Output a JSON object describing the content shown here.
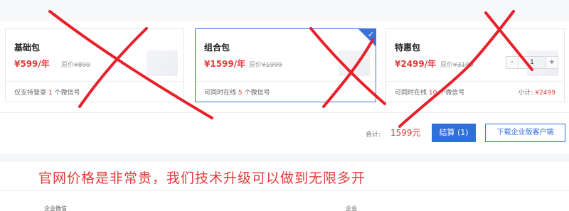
{
  "packages": [
    {
      "name": "基础包",
      "price": "¥599/年",
      "orig_label": "原价",
      "orig_price": "¥899",
      "desc_prefix": "仅支持登录",
      "desc_count": "1",
      "desc_suffix": "个微信号"
    },
    {
      "name": "组合包",
      "price": "¥1599/年",
      "orig_label": "原价",
      "orig_price": "¥1999",
      "desc_prefix": "可同时在线",
      "desc_count": "5",
      "desc_suffix": "个微信号",
      "selected": true
    },
    {
      "name": "特惠包",
      "price": "¥2499/年",
      "orig_label": "原价",
      "orig_price": "¥3199",
      "desc_prefix": "可同时在线",
      "desc_count": "10",
      "desc_suffix": "个微信号",
      "quantity": "1",
      "subtotal_label": "小计:",
      "subtotal_value": "¥2499"
    }
  ],
  "stepper": {
    "minus": "-",
    "plus": "+"
  },
  "checkmark_glyph": "✓",
  "summary": {
    "total_label": "合计:",
    "total_value": "1599元",
    "checkout_label": "结算 (1)",
    "download_label": "下载企业版客户端"
  },
  "banner_text": "官网价格是非常贵，我们技术升级可以做到无限多开",
  "bottom_fragments": [
    "企业微信",
    "企业"
  ],
  "colors": {
    "accent_blue": "#2f6fd8",
    "price_red": "#e23b3b",
    "annotation_red": "#e8202a"
  }
}
